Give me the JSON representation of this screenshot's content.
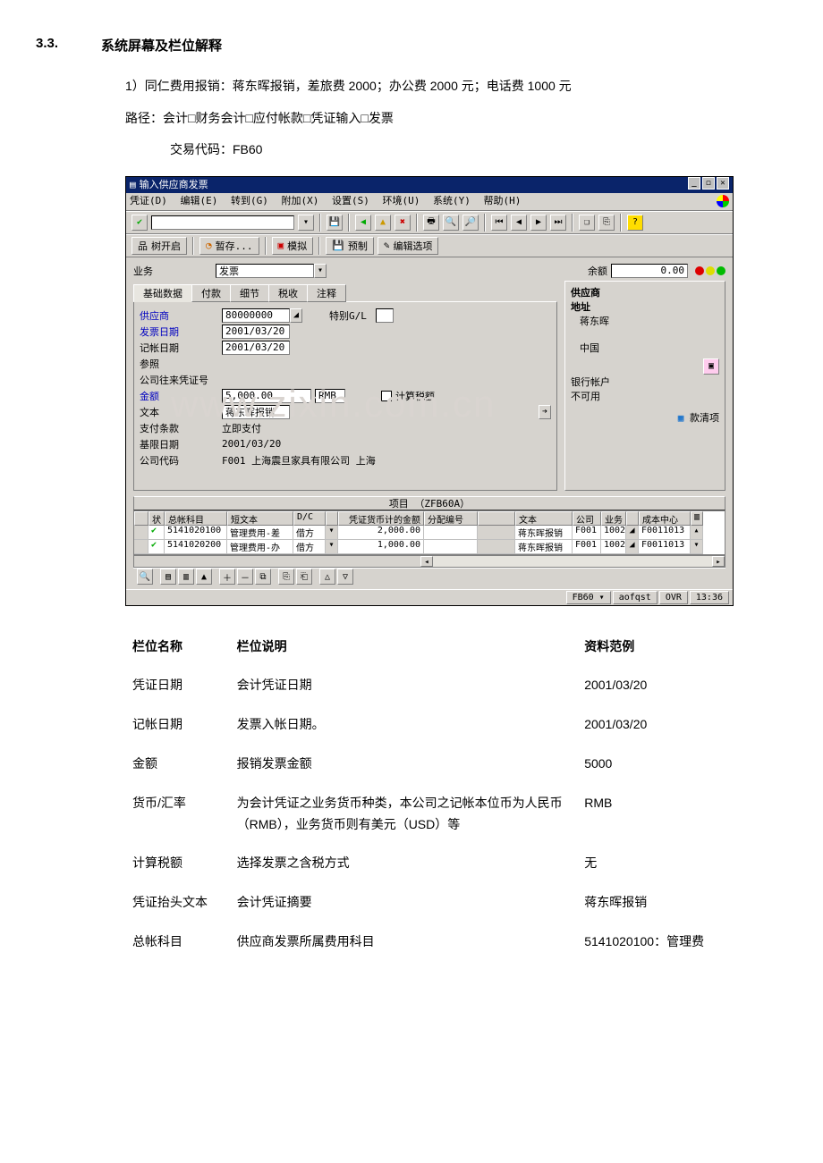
{
  "heading": {
    "number": "3.3.",
    "title": "系统屏幕及栏位解释"
  },
  "intro": {
    "line1": "1）同仁费用报销：蒋东晖报销，差旅费 2000；办公费 2000 元；电话费 1000 元",
    "line2": "路径：会计□财务会计□应付帐款□凭证输入□发票",
    "tx_code_line": "交易代码：FB60"
  },
  "sap": {
    "window_title": "输入供应商发票",
    "menu": [
      "凭证(D)",
      "编辑(E)",
      "转到(G)",
      "附加(X)",
      "设置(S)",
      "环境(U)",
      "系统(Y)",
      "帮助(H)"
    ],
    "app_toolbar": [
      {
        "icon": "tree-icon",
        "label": "树开启"
      },
      {
        "icon": "hold-icon",
        "label": "暂存..."
      },
      {
        "icon": "simulate-icon",
        "label": "模拟"
      },
      {
        "icon": "park-icon",
        "label": "预制"
      },
      {
        "icon": "pencil-icon",
        "label": "编辑选项"
      }
    ],
    "header": {
      "biz_label": "业务",
      "biz_value": "发票",
      "balance_label": "余额",
      "balance_value": "0.00"
    },
    "tabs": [
      "基础数据",
      "付款",
      "细节",
      "税收",
      "注释"
    ],
    "basic": {
      "vendor_label": "供应商",
      "vendor_value": "80000000",
      "special_gl_label": "特别G/L",
      "inv_date_label": "发票日期",
      "inv_date_value": "2001/03/20",
      "post_date_label": "记帐日期",
      "post_date_value": "2001/03/20",
      "ref_label": "参照",
      "xref_label": "公司往来凭证号",
      "amount_label": "金额",
      "amount_value": "5,000.00",
      "currency": "RMB",
      "calc_tax_label": "计算税额",
      "text_label": "文本",
      "text_value": "蒋东晖报销",
      "payterm_label": "支付条款",
      "payterm_value": "立即支付",
      "bline_label": "基限日期",
      "bline_value": "2001/03/20",
      "cocode_label": "公司代码",
      "cocode_value": "F001 上海震旦家具有限公司 上海"
    },
    "vendor_panel": {
      "title": "供应商",
      "address_label": "地址",
      "name": "蒋东晖",
      "country": "中国",
      "bank_label": "银行帐户",
      "bank_status": "不可用",
      "oi_button": "款清项"
    },
    "items_band": "项目  （ZFB60A）",
    "grid": {
      "headers": {
        "status": "状",
        "account": "总帐科目",
        "stext": "短文本",
        "dc": "D/C",
        "amount": "凭证货币计的金额",
        "assign": "分配编号",
        "text": "文本",
        "company": "公司",
        "busarea": "业务",
        "costctr": "成本中心"
      },
      "rows": [
        {
          "status_ok": true,
          "account": "5141020100",
          "stext": "管理费用-差",
          "dc": "借方",
          "amount": "2,000.00",
          "assign": "",
          "text": "蒋东晖报销",
          "company": "F001",
          "busarea": "1002",
          "costctr": "F0011013"
        },
        {
          "status_ok": true,
          "account": "5141020200",
          "stext": "管理费用-办",
          "dc": "借方",
          "amount": "1,000.00",
          "assign": "",
          "text": "蒋东晖报销",
          "company": "F001",
          "busarea": "1002",
          "costctr": "F0011013"
        }
      ]
    },
    "statusbar": {
      "tcode": "FB60 ▾",
      "sys": "aofqst",
      "mode": "OVR",
      "time": "13:36"
    }
  },
  "desc_table": {
    "headers": {
      "col1": "栏位名称",
      "col2": "栏位说明",
      "col3": "资料范例"
    },
    "rows": [
      {
        "n": "凭证日期",
        "d": "会计凭证日期",
        "e": "2001/03/20"
      },
      {
        "n": "记帐日期",
        "d": "发票入帐日期。",
        "e": "2001/03/20"
      },
      {
        "n": "金额",
        "d": "报销发票金额",
        "e": "5000"
      },
      {
        "n": "货币/汇率",
        "d": "为会计凭证之业务货币种类，本公司之记帐本位币为人民币（RMB），业务货币则有美元（USD）等",
        "e": "RMB"
      },
      {
        "n": "计算税额",
        "d": "选择发票之含税方式",
        "e": "无"
      },
      {
        "n": "凭证抬头文本",
        "d": "会计凭证摘要",
        "e": "蒋东晖报销"
      },
      {
        "n": "总帐科目",
        "d": "供应商发票所属费用科目",
        "e": "5141020100：管理费"
      }
    ]
  },
  "watermark": "www.zixin.com.cn"
}
